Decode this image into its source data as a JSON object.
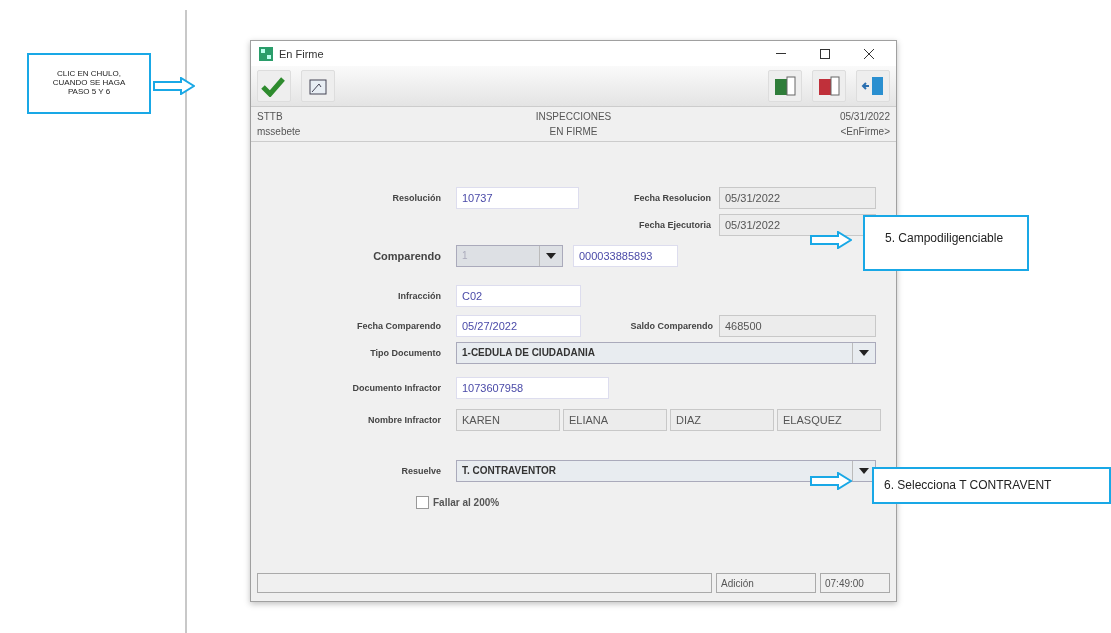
{
  "annotations": [
    {
      "text": "CLIC EN CHULO,\nCUANDO SE HAGA\nPASO 5 Y 6"
    },
    {
      "text": "5. Campodiligenciable"
    },
    {
      "text": "6. Selecciona T CONTRAVENT"
    }
  ],
  "window": {
    "title": "En Firme"
  },
  "header": {
    "left": [
      "STTB",
      "mssebete"
    ],
    "center": [
      "INSPECCIONES",
      "EN FIRME"
    ],
    "right": [
      "05/31/2022",
      "<EnFirme>"
    ]
  },
  "form": {
    "resolucion": {
      "label": "Resolución",
      "value": "10737",
      "editable": true
    },
    "fecha_resolucion": {
      "label": "Fecha Resolucion",
      "value": "05/31/2022",
      "editable": false
    },
    "fecha_ejecutoria": {
      "label": "Fecha Ejecutoria",
      "value": "05/31/2022",
      "editable": false
    },
    "comparendo": {
      "label": "Comparendo",
      "combo_value": "1",
      "disabled": true,
      "number": "000033885893"
    },
    "infraccion": {
      "label": "Infracción",
      "value": "C02",
      "editable": true
    },
    "fecha_comparendo": {
      "label": "Fecha Comparendo",
      "value": "05/27/2022",
      "editable": true
    },
    "saldo": {
      "label": "Saldo Comparendo",
      "value": "468500",
      "editable": false
    },
    "tipo_documento": {
      "label": "Tipo Documento",
      "value": "1-CEDULA DE CIUDADANIA",
      "disabled": false
    },
    "documento": {
      "label": "Documento Infractor",
      "value": "1073607958",
      "editable": true
    },
    "nombre": {
      "label": "Nombre Infractor",
      "parts": [
        "KAREN",
        "ELIANA",
        "DIAZ",
        "ELASQUEZ"
      ]
    },
    "resuelve": {
      "label": "Resuelve",
      "value": "T. CONTRAVENTOR",
      "disabled": false
    },
    "fallar": {
      "label": "Fallar al 200%",
      "checked": false
    }
  },
  "status_bar": {
    "mode": "Adición",
    "time": "07:49:00"
  }
}
